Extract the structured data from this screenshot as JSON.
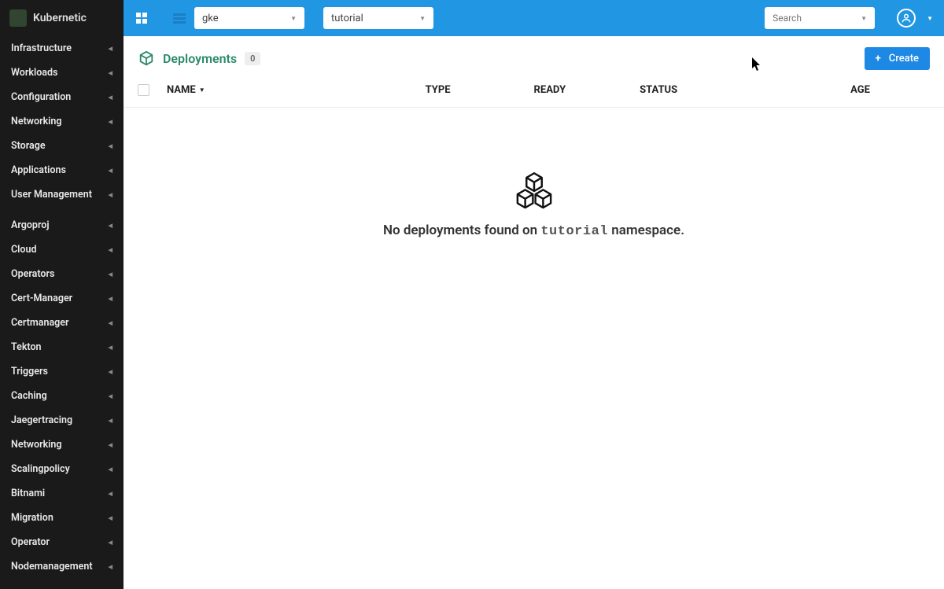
{
  "app": {
    "name": "Kubernetic"
  },
  "topbar": {
    "context_selector": "gke",
    "namespace_selector": "tutorial",
    "search_placeholder": "Search"
  },
  "sidebar": {
    "primary": [
      {
        "label": "Infrastructure"
      },
      {
        "label": "Workloads"
      },
      {
        "label": "Configuration"
      },
      {
        "label": "Networking"
      },
      {
        "label": "Storage"
      },
      {
        "label": "Applications"
      },
      {
        "label": "User Management"
      }
    ],
    "secondary": [
      {
        "label": "Argoproj"
      },
      {
        "label": "Cloud"
      },
      {
        "label": "Operators"
      },
      {
        "label": "Cert-Manager"
      },
      {
        "label": "Certmanager"
      },
      {
        "label": "Tekton"
      },
      {
        "label": "Triggers"
      },
      {
        "label": "Caching"
      },
      {
        "label": "Jaegertracing"
      },
      {
        "label": "Networking"
      },
      {
        "label": "Scalingpolicy"
      },
      {
        "label": "Bitnami"
      },
      {
        "label": "Migration"
      },
      {
        "label": "Operator"
      },
      {
        "label": "Nodemanagement"
      }
    ]
  },
  "page": {
    "title": "Deployments",
    "count": "0",
    "create_label": "Create"
  },
  "columns": {
    "name": "NAME",
    "type": "TYPE",
    "ready": "READY",
    "status": "STATUS",
    "age": "AGE"
  },
  "empty": {
    "prefix": "No deployments found on ",
    "namespace": "tutorial",
    "suffix": " namespace."
  }
}
